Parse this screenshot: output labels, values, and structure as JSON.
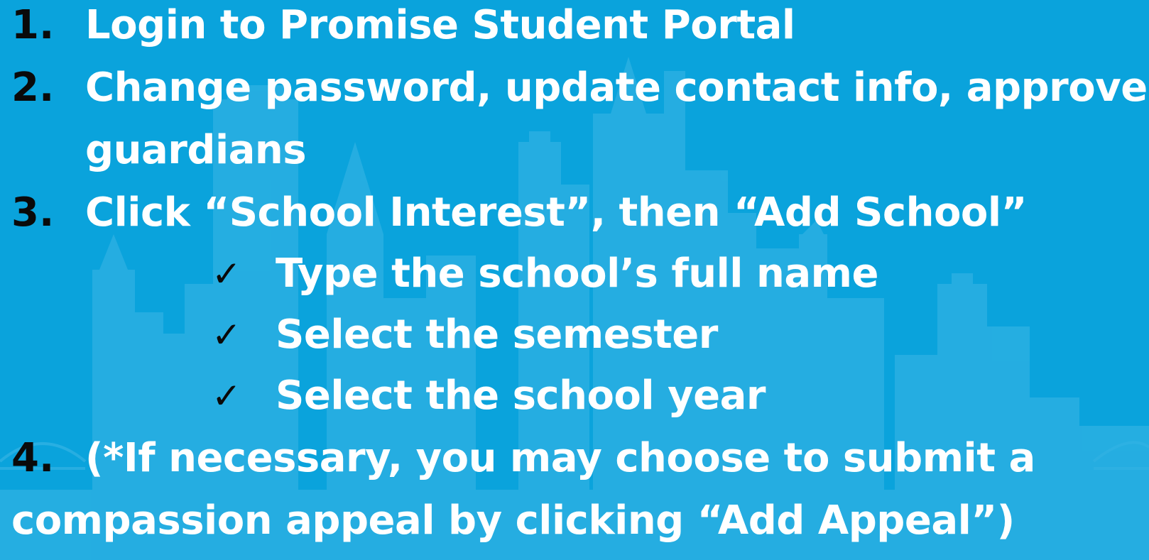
{
  "steps": [
    {
      "number": "1.",
      "text": "Login to Promise Student Portal"
    },
    {
      "number": "2.",
      "text": "Change password, update contact info, approve",
      "continuation": "guardians"
    },
    {
      "number": "3.",
      "text": "Click “School Interest”, then “Add School”"
    },
    {
      "number": "4.",
      "text": "(*If necessary, you may choose to submit a",
      "continuation": "compassion appeal by clicking “Add Appeal”)"
    }
  ],
  "substeps": [
    {
      "icon": "checkmark-icon",
      "glyph": "✓",
      "text": "Type the school’s full name"
    },
    {
      "icon": "checkmark-icon",
      "glyph": "✓",
      "text": "Select the semester"
    },
    {
      "icon": "checkmark-icon",
      "glyph": "✓",
      "text": "Select the school year"
    }
  ],
  "colors": {
    "background": "#0aa3dc",
    "text": "#ffffff",
    "numbers": "#0a0a0a",
    "skyline": "#3bb4e2"
  }
}
